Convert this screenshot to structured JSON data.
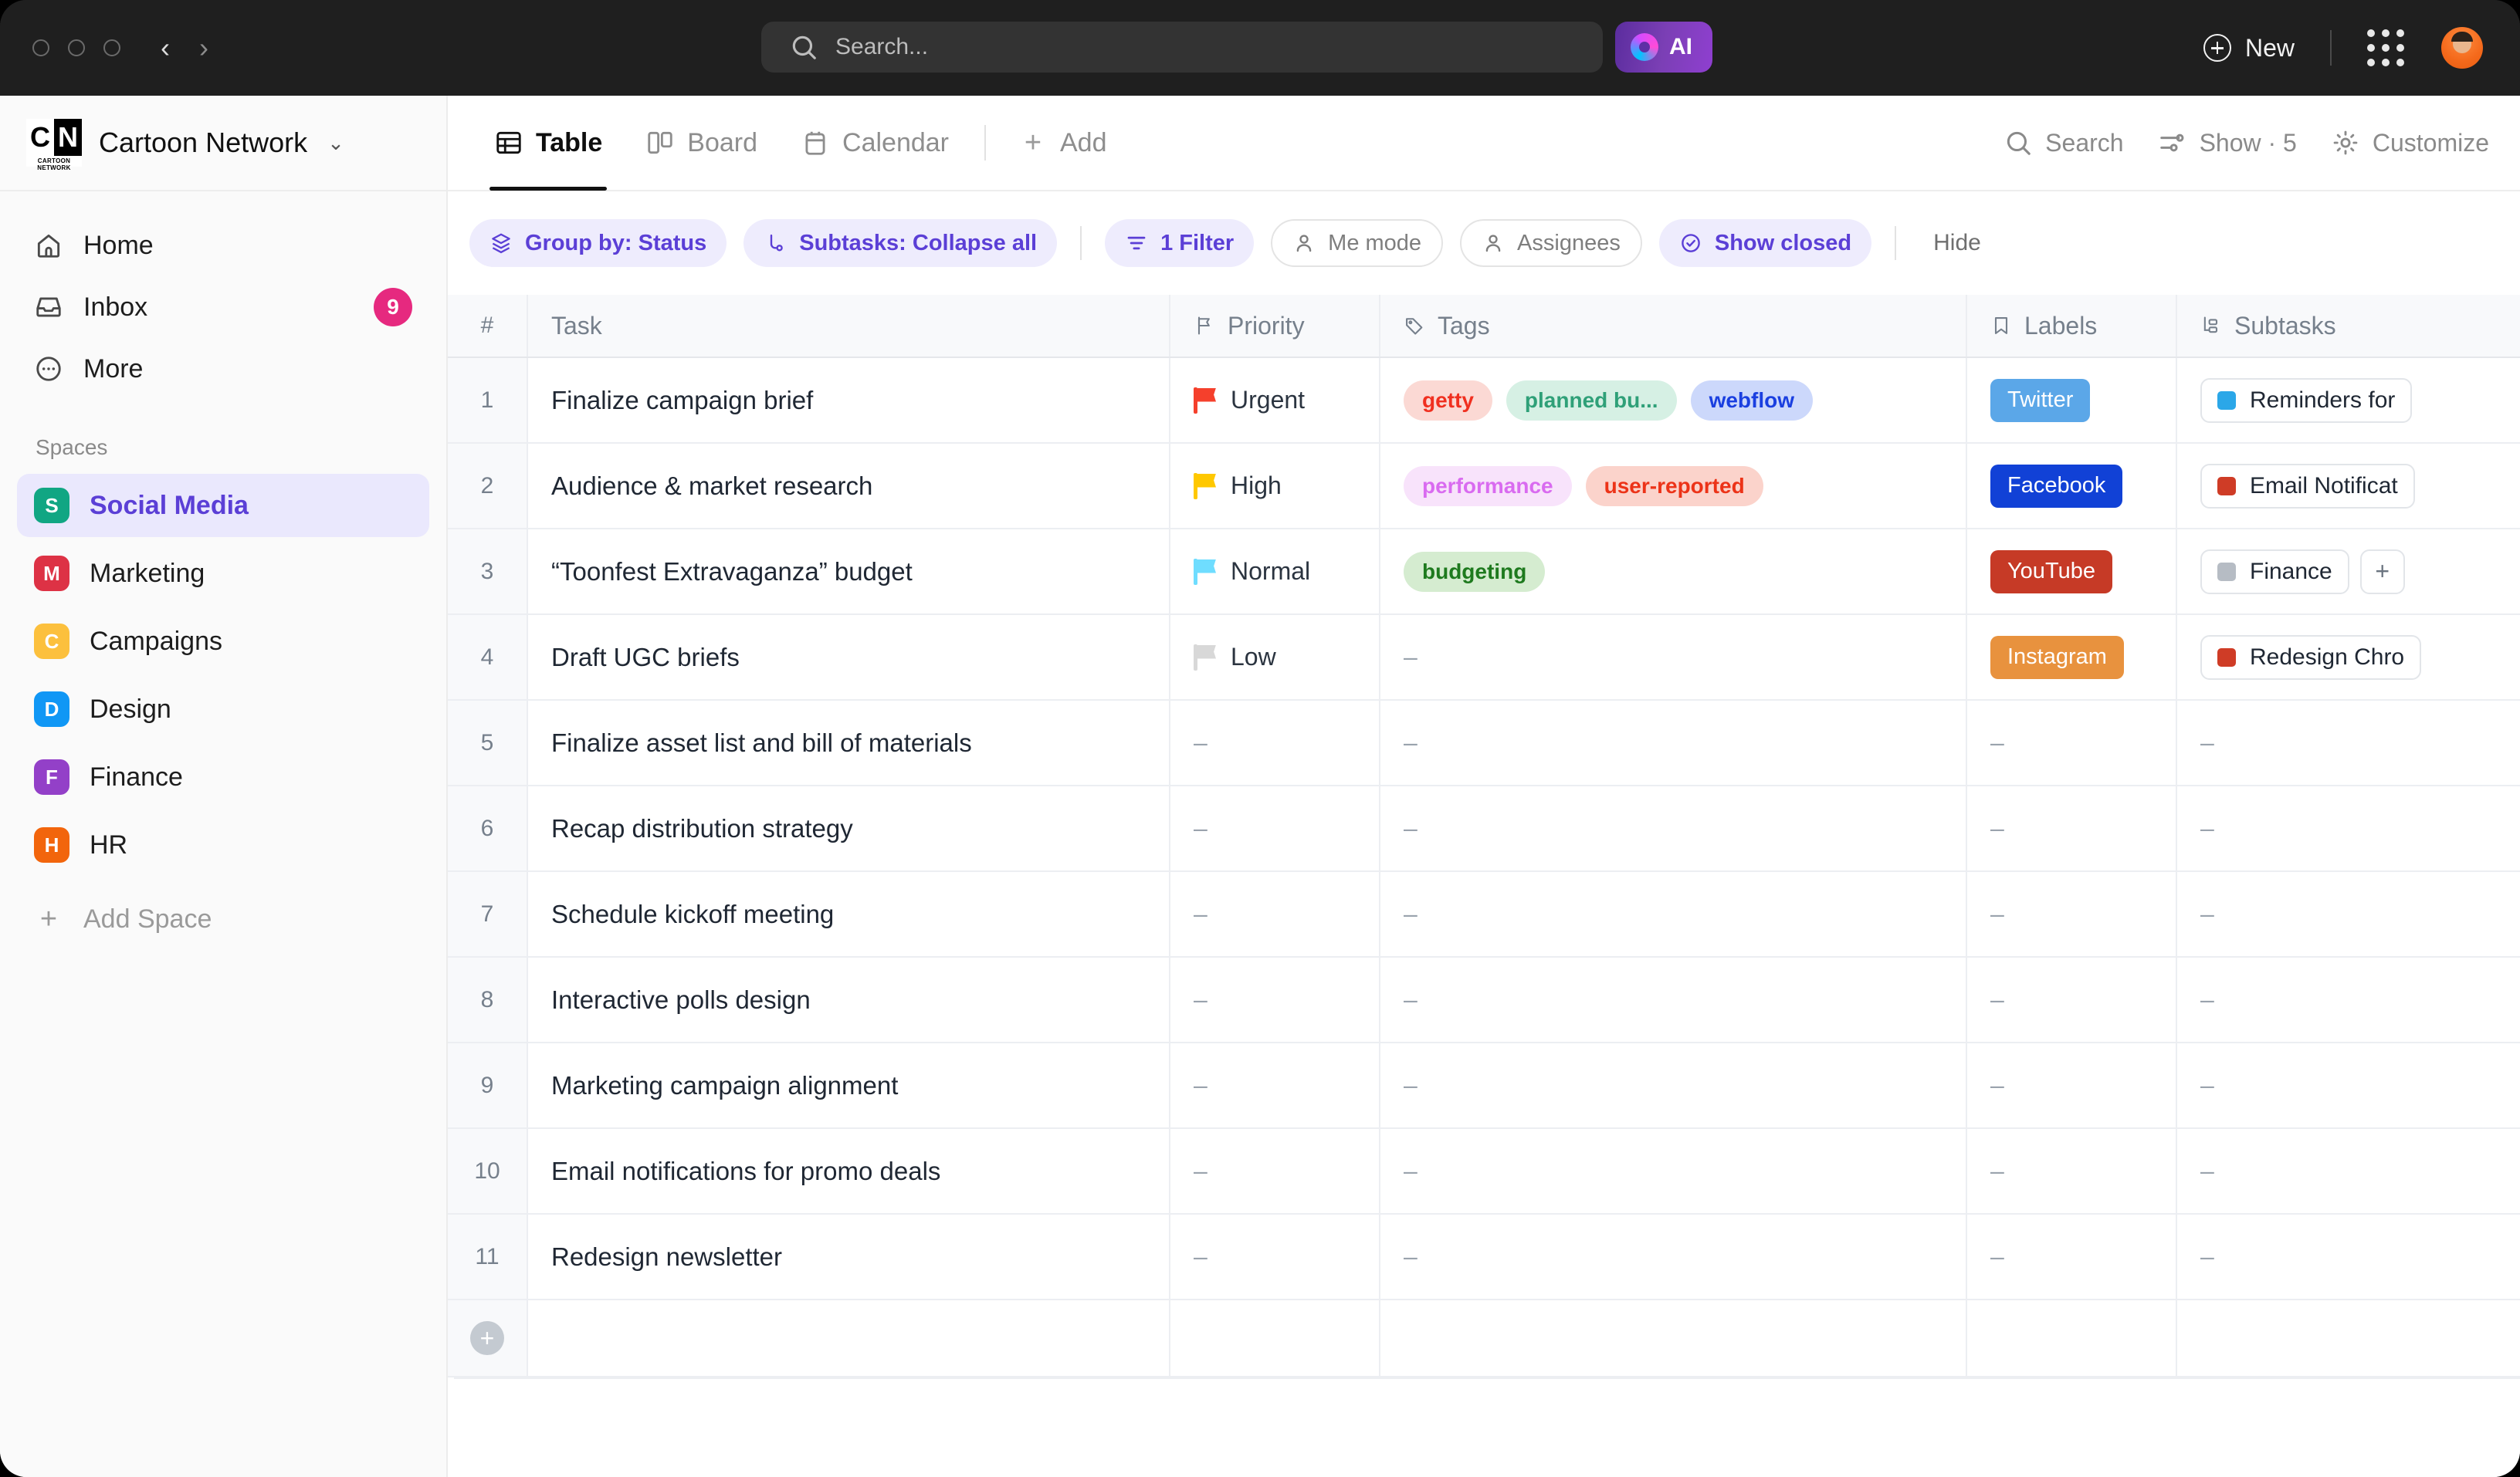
{
  "titlebar": {
    "search_placeholder": "Search...",
    "ai_label": "AI",
    "new_label": "New"
  },
  "sidebar": {
    "workspace_name": "Cartoon Network",
    "logo_text_left": "C",
    "logo_text_right": "N",
    "logo_caption": "CARTOON NETWORK",
    "nav": [
      {
        "label": "Home",
        "icon": "home-icon",
        "badge": ""
      },
      {
        "label": "Inbox",
        "icon": "inbox-icon",
        "badge": "9"
      },
      {
        "label": "More",
        "icon": "more-icon",
        "badge": ""
      }
    ],
    "spaces_label": "Spaces",
    "spaces": [
      {
        "label": "Social Media",
        "initial": "S",
        "color": "#11a683",
        "active": true
      },
      {
        "label": "Marketing",
        "initial": "M",
        "color": "#dd3245",
        "active": false
      },
      {
        "label": "Campaigns",
        "initial": "C",
        "color": "#fcc03d",
        "active": false
      },
      {
        "label": "Design",
        "initial": "D",
        "color": "#1097f5",
        "active": false
      },
      {
        "label": "Finance",
        "initial": "F",
        "color": "#9340c8",
        "active": false
      },
      {
        "label": "HR",
        "initial": "H",
        "color": "#f2650c",
        "active": false
      }
    ],
    "add_space_label": "Add Space"
  },
  "viewbar": {
    "tabs": [
      {
        "label": "Table",
        "icon": "table-icon",
        "active": true
      },
      {
        "label": "Board",
        "icon": "board-icon",
        "active": false
      },
      {
        "label": "Calendar",
        "icon": "calendar-icon",
        "active": false
      }
    ],
    "add_label": "Add",
    "actions": [
      {
        "label": "Search",
        "icon": "search-icon"
      },
      {
        "label": "Show · 5",
        "icon": "sliders-icon"
      },
      {
        "label": "Customize",
        "icon": "gear-icon"
      }
    ]
  },
  "filterbar": {
    "pills": [
      {
        "label": "Group by: Status",
        "icon": "layers-icon",
        "style": "purple"
      },
      {
        "label": "Subtasks: Collapse all",
        "icon": "subtask-icon",
        "style": "purple"
      },
      {
        "label": "1 Filter",
        "icon": "filter-icon",
        "style": "purple"
      },
      {
        "label": "Me mode",
        "icon": "person-icon",
        "style": "ghost"
      },
      {
        "label": "Assignees",
        "icon": "person-icon",
        "style": "ghost"
      },
      {
        "label": "Show closed",
        "icon": "check-circle-icon",
        "style": "purple"
      }
    ],
    "hide_label": "Hide"
  },
  "table": {
    "columns": [
      {
        "label": "#",
        "icon": ""
      },
      {
        "label": "Task",
        "icon": ""
      },
      {
        "label": "Priority",
        "icon": "flag-icon"
      },
      {
        "label": "Tags",
        "icon": "tag-icon"
      },
      {
        "label": "Labels",
        "icon": "bookmark-icon"
      },
      {
        "label": "Subtasks",
        "icon": "hierarchy-icon"
      }
    ],
    "empty_value": "–",
    "add_row_glyph": "+",
    "rows": [
      {
        "num": "1",
        "task": "Finalize campaign brief",
        "priority": {
          "label": "Urgent",
          "color": "#f5402c"
        },
        "tags": [
          {
            "label": "getty",
            "fg": "#f03020",
            "bg": "#fbd9d4"
          },
          {
            "label": "planned bu...",
            "fg": "#2fa078",
            "bg": "#d6f0e4"
          },
          {
            "label": "webflow",
            "fg": "#1a3fe0",
            "bg": "#ccd8fb"
          }
        ],
        "labels": [
          {
            "label": "Twitter",
            "bg": "#5ba7e8"
          }
        ],
        "subtasks": [
          {
            "label": "Reminders for",
            "dot": "#2ba7e8"
          }
        ],
        "has_add": false
      },
      {
        "num": "2",
        "task": "Audience & market research",
        "priority": {
          "label": "High",
          "color": "#ffc800"
        },
        "tags": [
          {
            "label": "performance",
            "fg": "#d96bf0",
            "bg": "#f8e3fb"
          },
          {
            "label": "user-reported",
            "fg": "#ec3318",
            "bg": "#fbd3cb"
          }
        ],
        "labels": [
          {
            "label": "Facebook",
            "bg": "#1141d6"
          }
        ],
        "subtasks": [
          {
            "label": "Email Notificat",
            "dot": "#cf3c26"
          }
        ],
        "has_add": false
      },
      {
        "num": "3",
        "task": "“Toonfest Extravaganza” budget",
        "priority": {
          "label": "Normal",
          "color": "#6fddff"
        },
        "tags": [
          {
            "label": "budgeting",
            "fg": "#1e7a1e",
            "bg": "#d5ecd0"
          }
        ],
        "labels": [
          {
            "label": "YouTube",
            "bg": "#c63a26"
          }
        ],
        "subtasks": [
          {
            "label": "Finance",
            "dot": "#b6bcc4"
          }
        ],
        "has_add": true
      },
      {
        "num": "4",
        "task": "Draft UGC briefs",
        "priority": {
          "label": "Low",
          "color": "#d8d8d8"
        },
        "tags": [],
        "labels": [
          {
            "label": "Instagram",
            "bg": "#e8923e"
          }
        ],
        "subtasks": [
          {
            "label": "Redesign Chro",
            "dot": "#cf3c26"
          }
        ],
        "has_add": false
      },
      {
        "num": "5",
        "task": "Finalize asset list and bill of materials",
        "priority": null,
        "tags": [],
        "labels": [],
        "subtasks": [],
        "has_add": false
      },
      {
        "num": "6",
        "task": "Recap distribution strategy",
        "priority": null,
        "tags": [],
        "labels": [],
        "subtasks": [],
        "has_add": false
      },
      {
        "num": "7",
        "task": "Schedule kickoff meeting",
        "priority": null,
        "tags": [],
        "labels": [],
        "subtasks": [],
        "has_add": false
      },
      {
        "num": "8",
        "task": "Interactive polls design",
        "priority": null,
        "tags": [],
        "labels": [],
        "subtasks": [],
        "has_add": false
      },
      {
        "num": "9",
        "task": "Marketing campaign alignment",
        "priority": null,
        "tags": [],
        "labels": [],
        "subtasks": [],
        "has_add": false
      },
      {
        "num": "10",
        "task": "Email notifications for promo deals",
        "priority": null,
        "tags": [],
        "labels": [],
        "subtasks": [],
        "has_add": false
      },
      {
        "num": "11",
        "task": "Redesign newsletter",
        "priority": null,
        "tags": [],
        "labels": [],
        "subtasks": [],
        "has_add": false
      }
    ]
  }
}
